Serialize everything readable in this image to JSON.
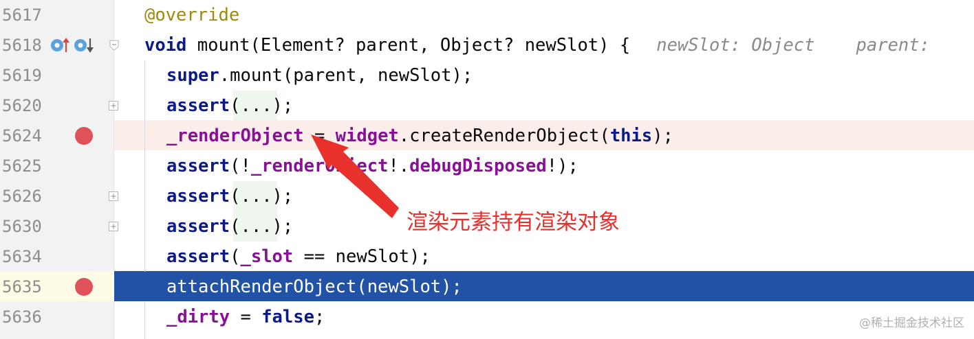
{
  "colors": {
    "keyword": "#0b1a84",
    "field": "#871094",
    "annotation": "#9e880d",
    "hint": "#8a8a8a",
    "selection": "#2252a5",
    "breakpoint": "#e0525a",
    "callout": "#e8312c",
    "breakpoint_line": "#fbeeea"
  },
  "line_numbers": [
    "5617",
    "5618",
    "5619",
    "5620",
    "5624",
    "5625",
    "5626",
    "5630",
    "5634",
    "5635",
    "5636"
  ],
  "gutter_icons": [
    "overrides-up-icon",
    "implemented-down-icon"
  ],
  "code": {
    "l5617": {
      "annotation": "@override"
    },
    "l5618": {
      "void": "void",
      "sig": " mount(Element? parent, Object? newSlot) {",
      "hint1": "newSlot: Object",
      "hint2": "parent:"
    },
    "l5619": {
      "kw": "super",
      "rest": ".mount(parent, newSlot);"
    },
    "l5620": {
      "fn": "assert",
      "open": "(",
      "fold": "...",
      "close": ");"
    },
    "l5624": {
      "field": "_renderObject",
      "eq": " = ",
      "widget": "widget",
      "call": ".createRenderObject(",
      "this": "this",
      "end": ");"
    },
    "l5625": {
      "fn": "assert",
      "a": "(!",
      "field": "_renderObject",
      "b": "!.",
      "prop": "debugDisposed",
      "c": "!);"
    },
    "l5626": {
      "fn": "assert",
      "open": "(",
      "fold": "...",
      "close": ");"
    },
    "l5630": {
      "fn": "assert",
      "open": "(",
      "fold": "...",
      "close": ");"
    },
    "l5634": {
      "fn": "assert",
      "a": "(",
      "field": "_slot",
      "b": " == newSlot);"
    },
    "l5635": {
      "text": "attachRenderObject(newSlot);"
    },
    "l5636": {
      "field": "_dirty",
      "eq": " = ",
      "kw": "false",
      "end": ";"
    }
  },
  "callout_text": "渲染元素持有渲染对象",
  "watermark": "@稀土掘金技术社区"
}
